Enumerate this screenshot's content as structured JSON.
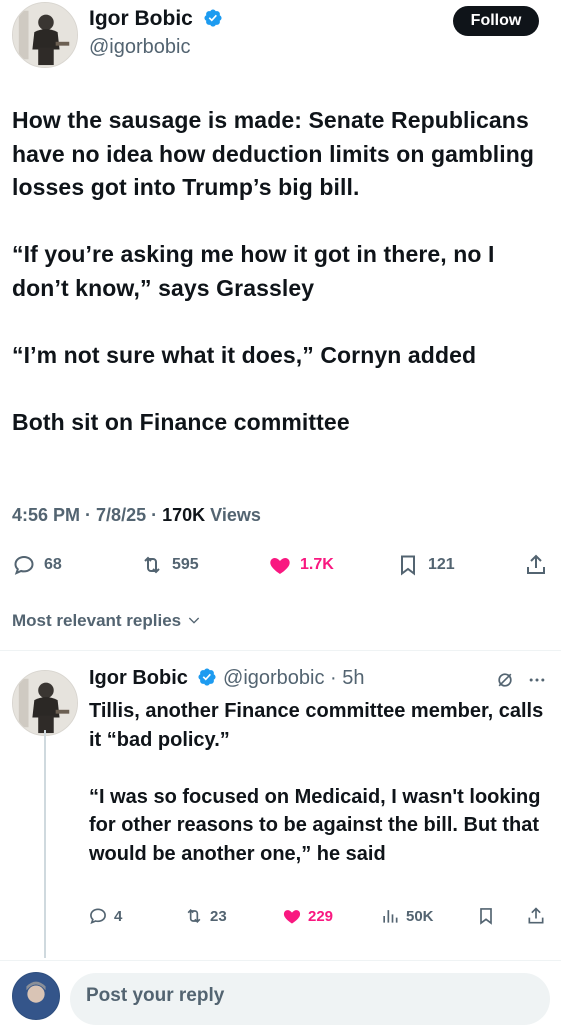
{
  "tweet": {
    "author_name": "Igor Bobic",
    "author_handle": "@igorbobic",
    "follow_label": "Follow",
    "paragraphs": [
      "How the sausage is made: Senate Republicans have no idea how deduction limits on gambling losses got into Trump’s big bill.",
      "“If you’re asking me how it got in there, no I don’t know,” says Grassley",
      "“I’m not sure what it does,” Cornyn added",
      "Both sit on Finance committee"
    ],
    "time": "4:56 PM",
    "date": "7/8/25",
    "views_count": "170K",
    "views_label": "Views",
    "replies": "68",
    "reposts": "595",
    "likes": "1.7K",
    "bookmarks": "121"
  },
  "replies_sort_label": "Most relevant replies",
  "reply": {
    "author_name": "Igor Bobic",
    "author_handle": "@igorbobic",
    "age": "5h",
    "paragraphs": [
      "Tillis, another Finance committee member, calls it “bad policy.”",
      "“I was so focused on Medicaid, I wasn't looking for other reasons to be against the bill. But that would be another one,” he said"
    ],
    "replies": "4",
    "reposts": "23",
    "likes": "229",
    "views": "50K"
  },
  "composer": {
    "placeholder": "Post your reply"
  },
  "colors": {
    "like": "#f91880",
    "verified": "#1d9bf0",
    "muted": "#536471",
    "text": "#0f1419"
  },
  "icons": [
    "verified-badge-icon",
    "reply-icon",
    "repost-icon",
    "heart-icon",
    "bookmark-icon",
    "share-icon",
    "views-icon",
    "grok-icon",
    "more-icon",
    "chevron-down-icon"
  ]
}
